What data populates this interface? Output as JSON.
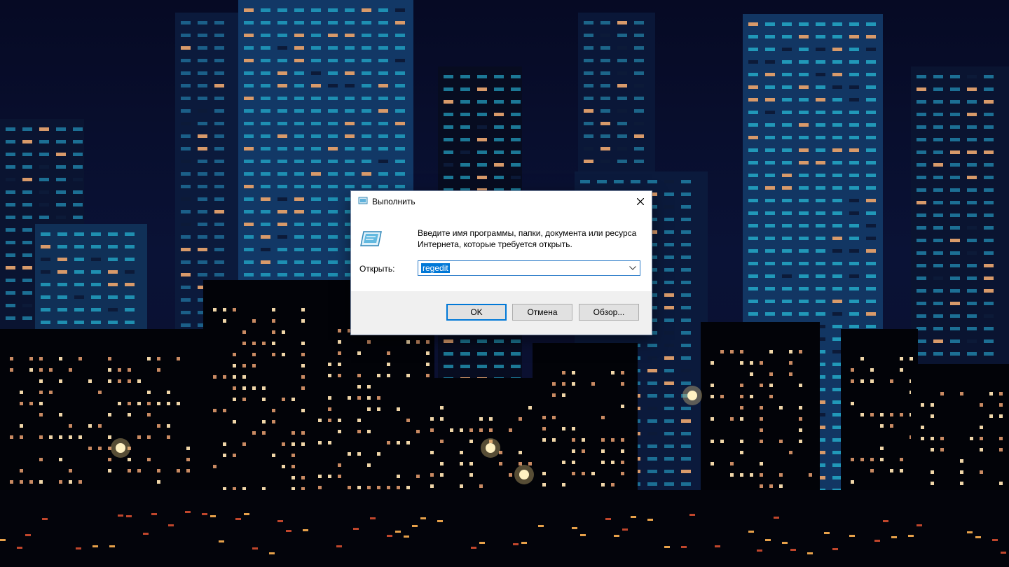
{
  "dialog": {
    "title": "Выполнить",
    "description": "Введите имя программы, папки, документа или ресурса Интернета, которые требуется открыть.",
    "open_label": "Открыть:",
    "open_value": "regedit",
    "ok_label": "OK",
    "cancel_label": "Отмена",
    "browse_label": "Обзор..."
  },
  "colors": {
    "selection": "#0078d7",
    "window_bg": "#ffffff",
    "footer_bg": "#f0f0f0",
    "night_sky": "#0a1236",
    "window_lights": "#1f8aa8"
  },
  "icons": [
    "run-app-icon",
    "close-icon",
    "chevron-down-icon"
  ]
}
